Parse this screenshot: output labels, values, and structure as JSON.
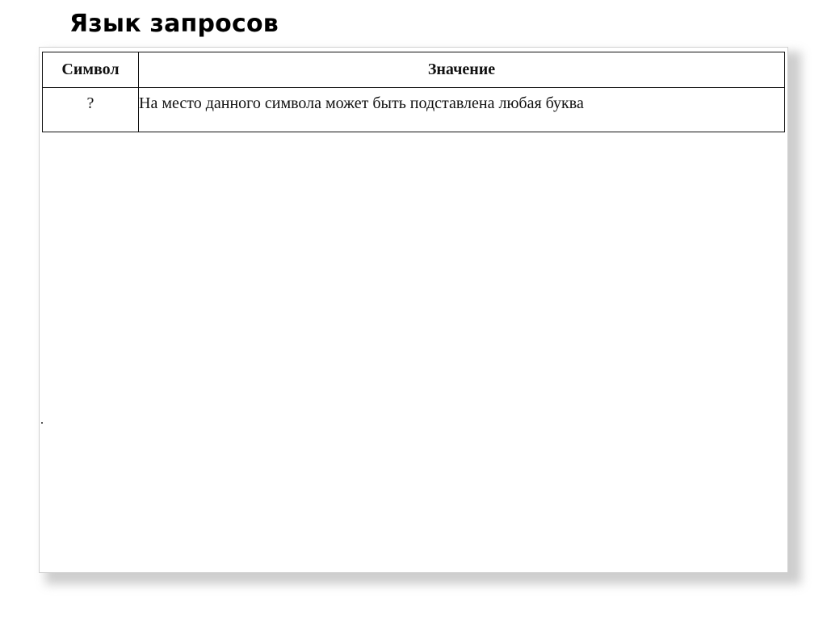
{
  "slide": {
    "title": "Язык запросов"
  },
  "table": {
    "headers": [
      "Символ",
      "Значение"
    ],
    "rows": [
      {
        "symbol": "?",
        "meaning": "На место данного символа может быть подставлена любая буква"
      }
    ]
  }
}
